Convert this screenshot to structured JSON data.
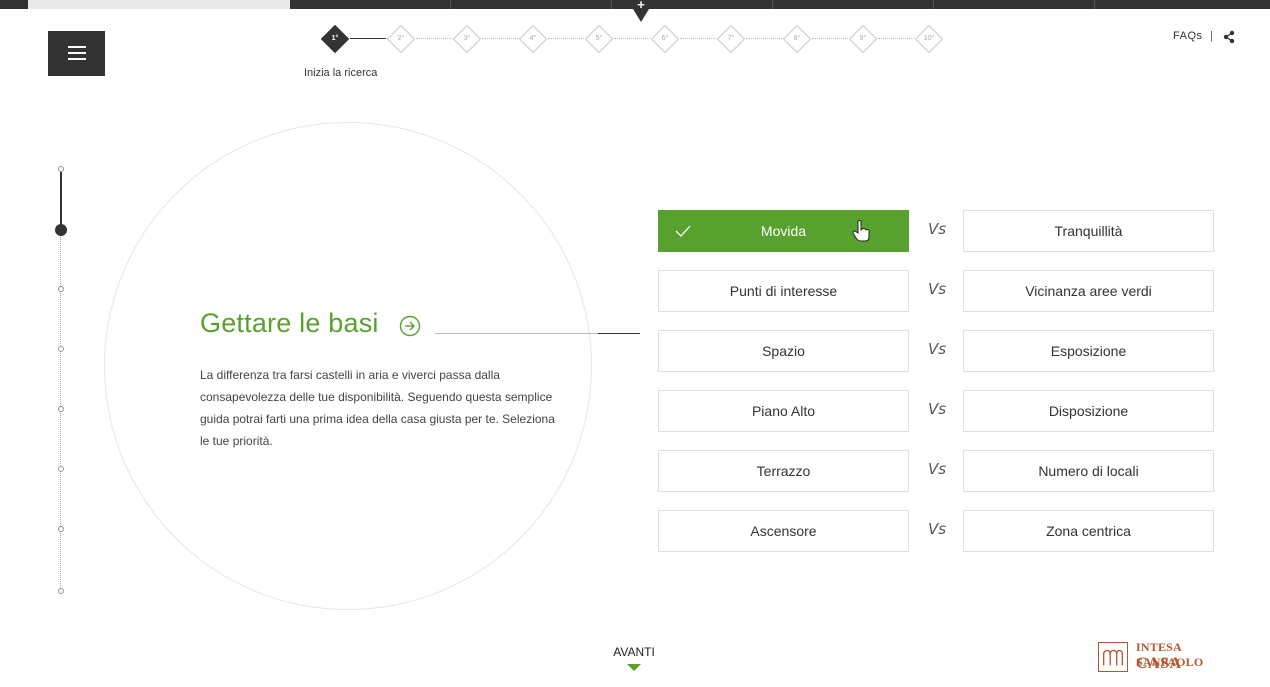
{
  "topbar": {
    "tab_symbol": "+"
  },
  "stepper": {
    "steps": [
      "1°",
      "2°",
      "3°",
      "4°",
      "5°",
      "6°",
      "7°",
      "8°",
      "9°",
      "10°"
    ],
    "active_index": 0,
    "caption": "Inizia la ricerca"
  },
  "header": {
    "faqs": "FAQs",
    "pipe": "|"
  },
  "section": {
    "title": "Gettare le basi",
    "description": "La differenza tra farsi castelli in aria e viverci passa dalla consapevolezza delle tue disponibilità. Seguendo questa semplice guida potrai farti una prima idea della casa giusta per te. Seleziona le tue priorità."
  },
  "options": {
    "vs_label": "Vs",
    "rows": [
      {
        "left": "Movida",
        "right": "Tranquillità",
        "selected": "left"
      },
      {
        "left": "Punti di interesse",
        "right": "Vicinanza aree verdi",
        "selected": ""
      },
      {
        "left": "Spazio",
        "right": "Esposizione",
        "selected": ""
      },
      {
        "left": "Piano Alto",
        "right": "Disposizione",
        "selected": ""
      },
      {
        "left": "Terrazzo",
        "right": "Numero di locali",
        "selected": ""
      },
      {
        "left": "Ascensore",
        "right": "Zona centrica",
        "selected": ""
      }
    ]
  },
  "footer": {
    "next_label": "AVANTI",
    "logo_line1": "INTESA SANPAOLO",
    "logo_line2": "CASA"
  },
  "colors": {
    "accent_green": "#58a12f",
    "dark": "#333333",
    "brand_logo": "#b7562e"
  },
  "icons": [
    "menu-icon",
    "share-icon",
    "arrow-circle-right-icon",
    "check-icon",
    "hand-cursor-icon",
    "chevron-down-icon"
  ]
}
